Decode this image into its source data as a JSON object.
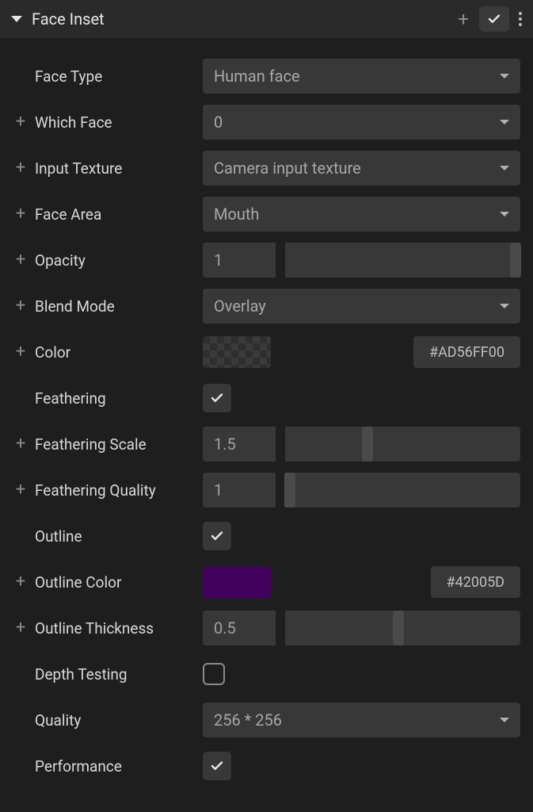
{
  "header": {
    "title": "Face Inset"
  },
  "rows": {
    "faceType": {
      "label": "Face Type",
      "value": "Human face"
    },
    "whichFace": {
      "label": "Which Face",
      "value": "0"
    },
    "inputTexture": {
      "label": "Input Texture",
      "value": "Camera input texture"
    },
    "faceArea": {
      "label": "Face Area",
      "value": "Mouth"
    },
    "opacity": {
      "label": "Opacity",
      "value": "1",
      "slider_pct": 98
    },
    "blendMode": {
      "label": "Blend Mode",
      "value": "Overlay"
    },
    "color": {
      "label": "Color",
      "hex": "#AD56FF00",
      "swatch": "checker"
    },
    "feathering": {
      "label": "Feathering",
      "checked": true
    },
    "featherScale": {
      "label": "Feathering Scale",
      "value": "1.5",
      "slider_pct": 35
    },
    "featherQuality": {
      "label": "Feathering Quality",
      "value": "1",
      "slider_pct": 2
    },
    "outline": {
      "label": "Outline",
      "checked": true
    },
    "outlineColor": {
      "label": "Outline Color",
      "hex": "#42005D",
      "swatch": "#42005D"
    },
    "outlineThick": {
      "label": "Outline Thickness",
      "value": "0.5",
      "slider_pct": 48
    },
    "depthTesting": {
      "label": "Depth Testing",
      "checked": false
    },
    "quality": {
      "label": "Quality",
      "value": "256 * 256"
    },
    "performance": {
      "label": "Performance",
      "checked": true
    }
  }
}
